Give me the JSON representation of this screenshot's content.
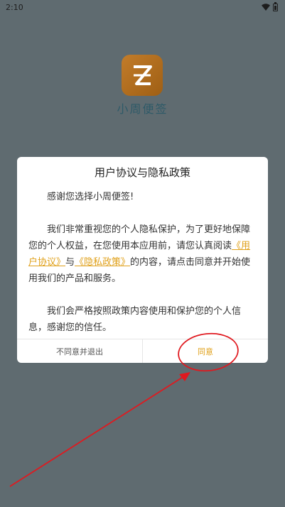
{
  "status_bar": {
    "time": "2:10"
  },
  "app": {
    "name": "小周便签"
  },
  "dialog": {
    "title": "用户协议与隐私政策",
    "greeting": "感谢您选择小周便签!",
    "para2_a": "我们非常重视您的个人隐私保护，为了更好地保障您的个人权益，在您使用本应用前，请您认真阅读",
    "link_user_agreement": "《用户协议》",
    "para2_and": "与",
    "link_privacy_policy": "《隐私政策》",
    "para2_b": "的内容，请点击同意并开始使用我们的产品和服务。",
    "para3": "我们会严格按照政策内容使用和保护您的个人信息，感谢您的信任。",
    "disagree_label": "不同意并退出",
    "agree_label": "同意"
  },
  "colors": {
    "accent": "#e0a11b",
    "backdrop": "#5f6b70",
    "logo": "#b06d1e",
    "annotation": "#e0191f"
  },
  "icons": [
    "wifi-icon",
    "battery-icon",
    "app-logo-icon"
  ]
}
